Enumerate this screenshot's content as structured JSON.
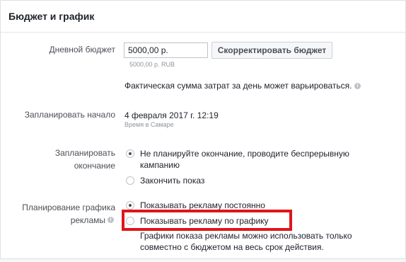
{
  "section_title": "Бюджет и график",
  "daily_budget": {
    "label": "Дневной бюджет",
    "value": "5000,00 р.",
    "hint": "5000,00 р. RUB",
    "adjust_button": "Скорректировать бюджет",
    "note": "Фактическая сумма затрат за день может варьироваться."
  },
  "schedule_start": {
    "label": "Запланировать начало",
    "value": "4 февраля 2017 г. 12:19",
    "timezone": "Время в Самаре"
  },
  "schedule_end": {
    "label_line1": "Запланировать",
    "label_line2": "окончание",
    "option1_line1": "Не планируйте окончание, проводите беспрерывную",
    "option1_line2": "кампанию",
    "option2": "Закончить показ"
  },
  "ad_scheduling": {
    "label_line1": "Планирование графика",
    "label_line2": "рекламы",
    "option1": "Показывать рекламу постоянно",
    "option2": "Показывать рекламу по графику",
    "note_line1": "Графики показа рекламы можно использовать только",
    "note_line2": "совместно с бюджетом на весь срок действия."
  },
  "colors": {
    "highlight_border": "#e0151b",
    "radio_selected_dot": "#4b4f56"
  }
}
